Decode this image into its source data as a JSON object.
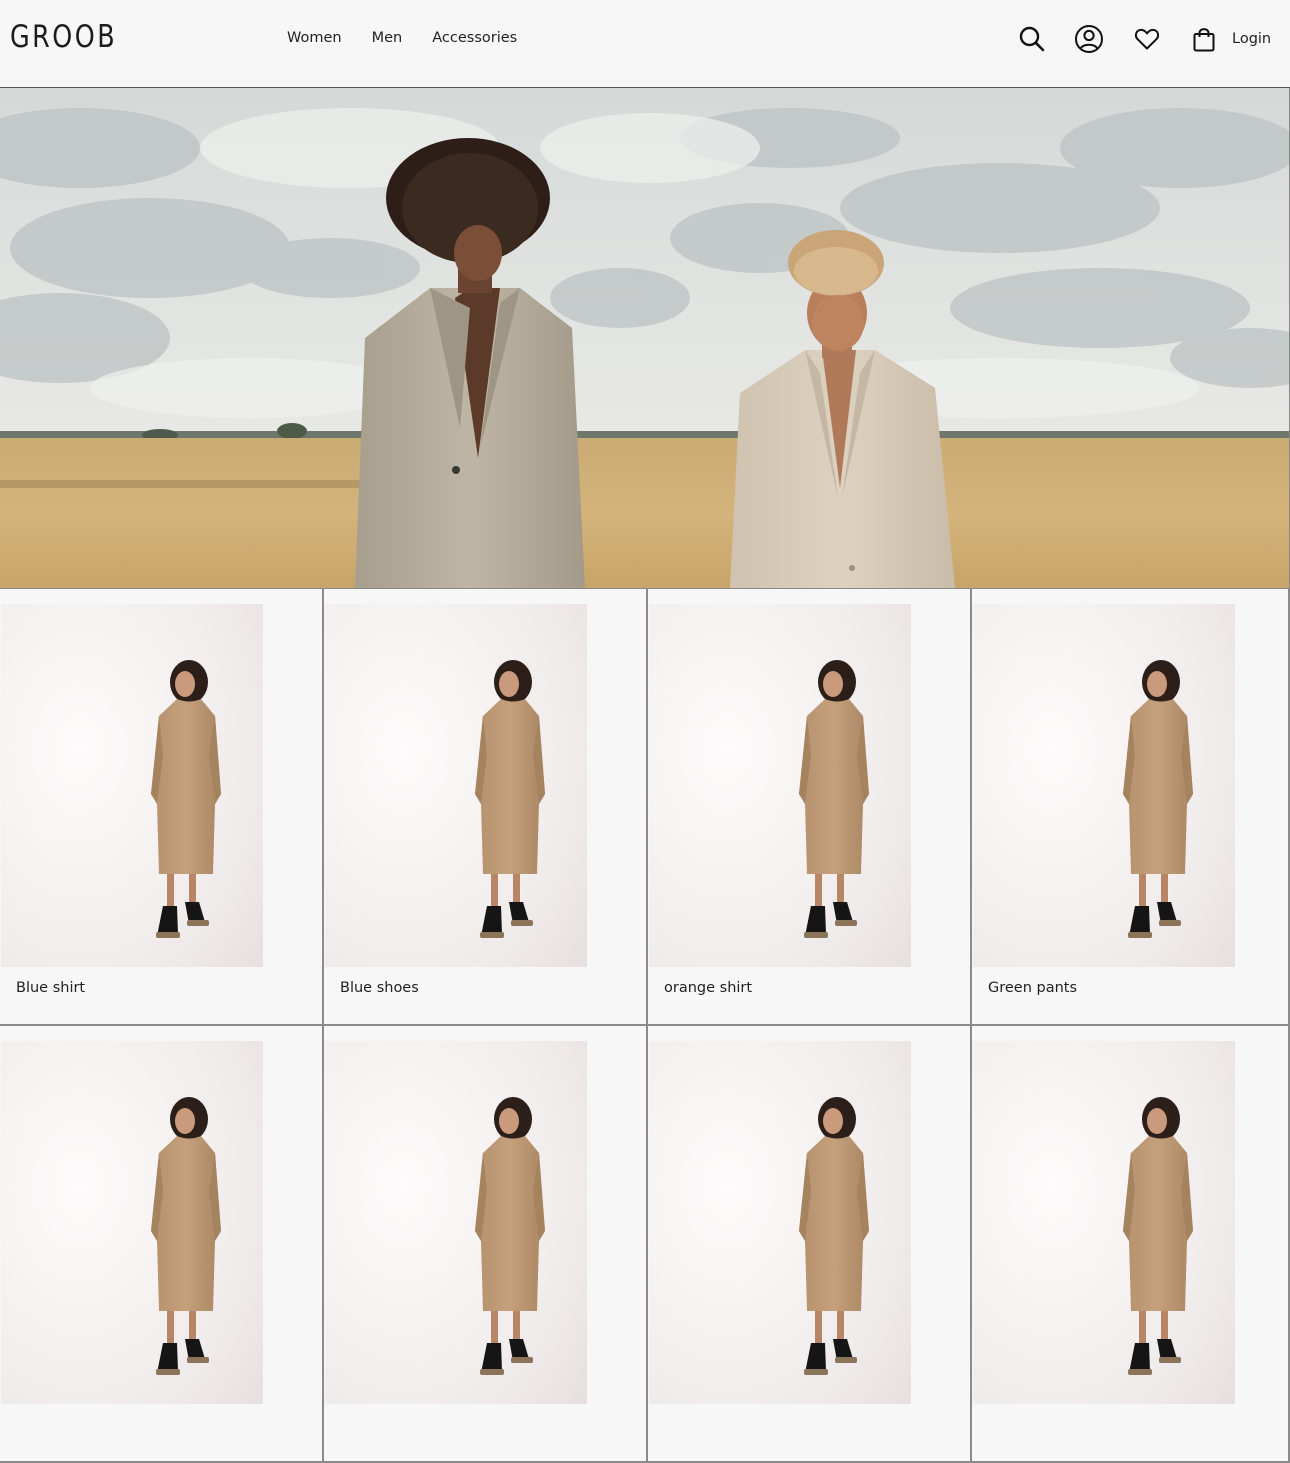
{
  "brand": {
    "logo_text": "GROOB"
  },
  "nav": {
    "items": [
      {
        "label": "Women"
      },
      {
        "label": "Men"
      },
      {
        "label": "Accessories"
      }
    ]
  },
  "header_actions": {
    "icons": [
      "search-icon",
      "account-icon",
      "wishlist-heart-icon",
      "shopping-bag-icon"
    ],
    "login_label": "Login"
  },
  "hero": {
    "image": "two models in beige blazers standing in a wheat field under a cloudy sky"
  },
  "products": [
    {
      "name": "Blue shirt"
    },
    {
      "name": "Blue shoes"
    },
    {
      "name": "orange shirt"
    },
    {
      "name": "Green pants"
    },
    {
      "name": ""
    },
    {
      "name": ""
    },
    {
      "name": ""
    },
    {
      "name": ""
    }
  ],
  "colors": {
    "page_bg": "#f7f7f7",
    "text": "#222222",
    "divider": "#8a8a8a"
  }
}
